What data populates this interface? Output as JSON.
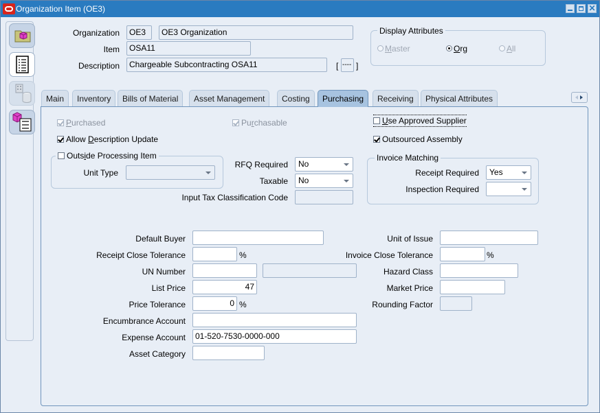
{
  "window": {
    "title": "Organization Item (OE3)",
    "controls": [
      "minimize",
      "maximize",
      "close"
    ]
  },
  "sidebar": {
    "items": [
      {
        "icon": "folder-cube-icon",
        "state": "normal"
      },
      {
        "icon": "list-document-icon",
        "state": "active"
      },
      {
        "icon": "building-cylinder-icon",
        "state": "disabled"
      },
      {
        "icon": "cube-numbered-list-icon",
        "state": "normal"
      }
    ]
  },
  "header": {
    "organization_label": "Organization",
    "organization_code": "OE3",
    "organization_name": "OE3 Organization",
    "item_label": "Item",
    "item_value": "OSA11",
    "description_label": "Description",
    "description_value": "Chargeable Subcontracting OSA11",
    "flex_field": "----",
    "flex_open": "[",
    "flex_close": "]"
  },
  "display_attributes": {
    "title": "Display Attributes",
    "options": [
      {
        "label_prefix": "",
        "label_ul": "M",
        "label_rest": "aster",
        "selected": false,
        "enabled": false
      },
      {
        "label_prefix": "",
        "label_ul": "O",
        "label_rest": "rg",
        "selected": true,
        "enabled": true
      },
      {
        "label_prefix": "",
        "label_ul": "A",
        "label_rest": "ll",
        "selected": false,
        "enabled": false
      }
    ]
  },
  "tabs": [
    {
      "label": "Main",
      "active": false
    },
    {
      "label": "Inventory",
      "active": false
    },
    {
      "label": "Bills of Material",
      "active": false
    },
    {
      "label": "Asset Management",
      "active": false
    },
    {
      "label": "Costing",
      "active": false
    },
    {
      "label": "Purchasing",
      "active": true
    },
    {
      "label": "Receiving",
      "active": false
    },
    {
      "label": "Physical Attributes",
      "active": false
    }
  ],
  "purchasing": {
    "purchased": {
      "ul": "P",
      "rest": "urchased",
      "checked": true,
      "enabled": false
    },
    "purchasable": {
      "pre": "Pu",
      "ul": "r",
      "rest": "chasable",
      "checked": true,
      "enabled": false
    },
    "use_approved_supplier": {
      "ul": "U",
      "rest": "se Approved Supplier",
      "checked": false,
      "enabled": true
    },
    "allow_description_update": {
      "pre": "Allow ",
      "ul": "D",
      "rest": "escription Update",
      "checked": true,
      "enabled": true
    },
    "outsourced_assembly": {
      "label": "Outsourced Assembly",
      "checked": true,
      "enabled": true
    },
    "outside_processing": {
      "pre": "Outs",
      "ul": "i",
      "rest": "de Processing Item",
      "checked": false
    },
    "unit_type": {
      "label": "Unit Type",
      "value": ""
    },
    "rfq_required": {
      "label": "RFQ Required",
      "value": "No"
    },
    "taxable": {
      "label": "Taxable",
      "value": "No"
    },
    "input_tax_code": {
      "label": "Input Tax Classification Code",
      "value": ""
    },
    "invoice_matching": {
      "title": "Invoice Matching",
      "receipt_required": {
        "label": "Receipt Required",
        "value": "Yes"
      },
      "inspection_required": {
        "label": "Inspection Required",
        "value": ""
      }
    },
    "default_buyer": {
      "label": "Default Buyer",
      "value": ""
    },
    "receipt_close_tolerance": {
      "label": "Receipt Close Tolerance",
      "value": "",
      "unit": "%"
    },
    "un_number": {
      "label": "UN Number",
      "value": "",
      "description": ""
    },
    "list_price": {
      "label": "List Price",
      "value": "47"
    },
    "price_tolerance": {
      "label": "Price Tolerance",
      "value": "0",
      "unit": "%"
    },
    "encumbrance_account": {
      "label": "Encumbrance Account",
      "value": ""
    },
    "expense_account": {
      "label": "Expense Account",
      "value": "01-520-7530-0000-000"
    },
    "asset_category": {
      "label": "Asset Category",
      "value": ""
    },
    "unit_of_issue": {
      "label": "Unit of Issue",
      "value": ""
    },
    "invoice_close_tolerance": {
      "label": "Invoice Close Tolerance",
      "value": "",
      "unit": "%"
    },
    "hazard_class": {
      "label": "Hazard Class",
      "value": ""
    },
    "market_price": {
      "label": "Market Price",
      "value": ""
    },
    "rounding_factor": {
      "label": "Rounding Factor",
      "value": ""
    }
  }
}
